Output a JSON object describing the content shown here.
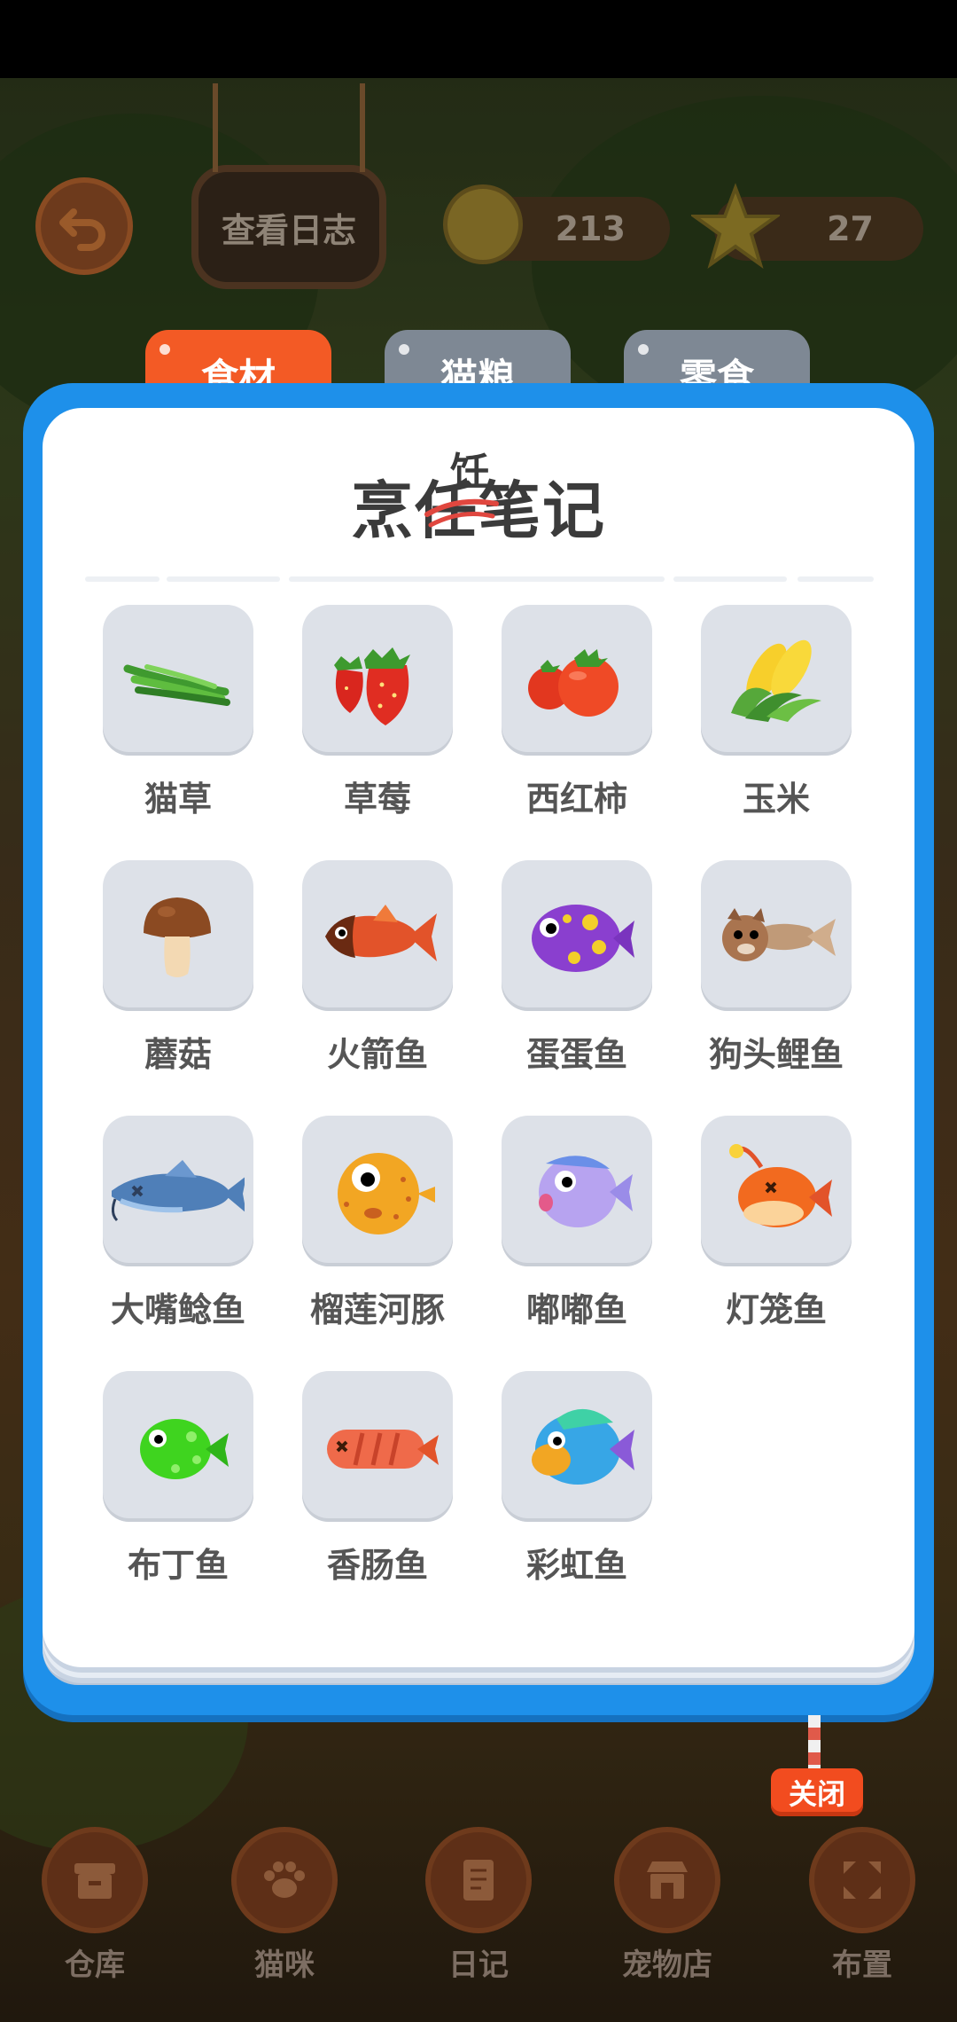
{
  "hud": {
    "log_button_label": "查看日志",
    "coins": "213",
    "stars": "27"
  },
  "tabs": [
    {
      "label": "食材",
      "active": true
    },
    {
      "label": "猫粮",
      "active": false
    },
    {
      "label": "零食",
      "active": false
    }
  ],
  "notebook": {
    "title_parts": [
      "烹",
      "任",
      "笔记"
    ],
    "title_correction": "饪"
  },
  "ingredients": [
    {
      "name": "猫草",
      "icon": "cat-grass-icon"
    },
    {
      "name": "草莓",
      "icon": "strawberry-icon"
    },
    {
      "name": "西红柿",
      "icon": "tomato-icon"
    },
    {
      "name": "玉米",
      "icon": "corn-icon"
    },
    {
      "name": "蘑菇",
      "icon": "mushroom-icon"
    },
    {
      "name": "火箭鱼",
      "icon": "rocket-fish-icon"
    },
    {
      "name": "蛋蛋鱼",
      "icon": "egg-fish-icon"
    },
    {
      "name": "狗头鲤鱼",
      "icon": "dog-head-carp-icon"
    },
    {
      "name": "大嘴鲶鱼",
      "icon": "big-mouth-catfish-icon"
    },
    {
      "name": "榴莲河豚",
      "icon": "durian-pufferfish-icon"
    },
    {
      "name": "嘟嘟鱼",
      "icon": "dudu-fish-icon"
    },
    {
      "name": "灯笼鱼",
      "icon": "lantern-fish-icon"
    },
    {
      "name": "布丁鱼",
      "icon": "pudding-fish-icon"
    },
    {
      "name": "香肠鱼",
      "icon": "sausage-fish-icon"
    },
    {
      "name": "彩虹鱼",
      "icon": "rainbow-fish-icon"
    }
  ],
  "close_label": "关闭",
  "bottom_nav": [
    {
      "label": "仓库",
      "icon": "warehouse-icon"
    },
    {
      "label": "猫咪",
      "icon": "paw-icon"
    },
    {
      "label": "日记",
      "icon": "diary-icon"
    },
    {
      "label": "宠物店",
      "icon": "pet-shop-icon"
    },
    {
      "label": "布置",
      "icon": "arrange-icon"
    }
  ],
  "colors": {
    "panel_blue": "#1e90ea",
    "tab_active": "#f35a25",
    "tab_inactive": "#7e8894",
    "close_red": "#f24c1f"
  }
}
